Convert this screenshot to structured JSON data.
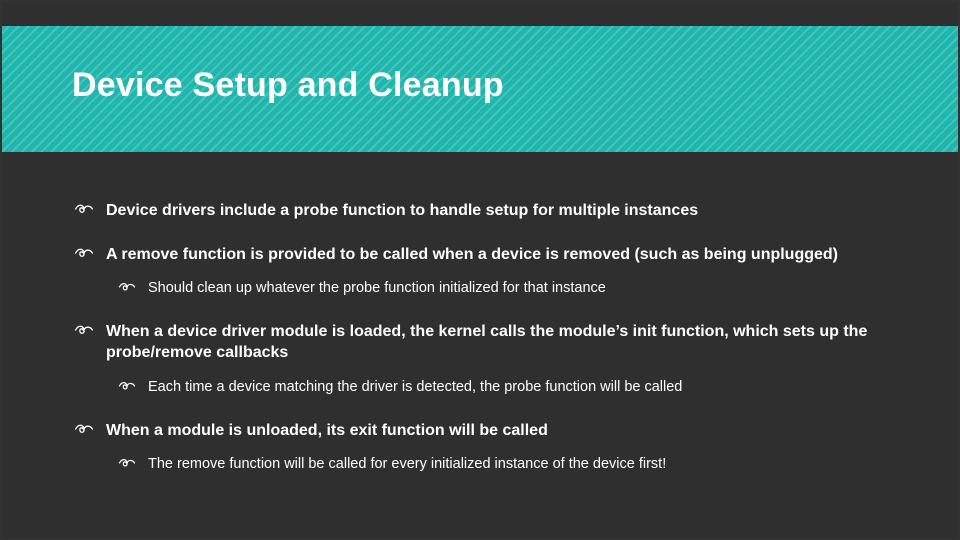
{
  "colors": {
    "accent": "#1fb6ad",
    "panel": "#2f2f2f",
    "text": "#ffffff"
  },
  "slide": {
    "title": "Device Setup and Cleanup",
    "bullets": [
      {
        "text": "Device drivers include a probe function to handle setup for multiple instances",
        "children": []
      },
      {
        "text": "A remove function is provided to be called when a device is removed (such as being unplugged)",
        "children": [
          {
            "text": "Should clean up whatever the probe function initialized for that instance"
          }
        ]
      },
      {
        "text": "When a device driver module is loaded, the kernel calls the module’s init function, which sets up the probe/remove callbacks",
        "children": [
          {
            "text": "Each time a device matching the driver is detected, the probe function will be called"
          }
        ]
      },
      {
        "text": "When a module is unloaded, its exit function will be called",
        "children": [
          {
            "text": "The remove function will be called for every initialized instance of the device first!"
          }
        ]
      }
    ]
  }
}
